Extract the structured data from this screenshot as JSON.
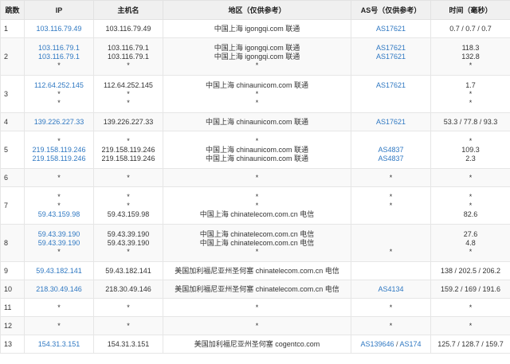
{
  "headers": {
    "hop": "跳数",
    "ip": "IP",
    "host": "主机名",
    "geo": "地区（仅供参考）",
    "as": "AS号（仅供参考）",
    "time": "时间（毫秒）"
  },
  "rows": [
    {
      "hop": "1",
      "ip": [
        "103.116.79.49"
      ],
      "host": [
        "103.116.79.49"
      ],
      "geo": [
        "中国上海 igongqi.com 联通"
      ],
      "as": [
        [
          "AS17621"
        ]
      ],
      "time": [
        "0.7 / 0.7 / 0.7"
      ]
    },
    {
      "hop": "2",
      "ip": [
        "103.116.79.1",
        "103.116.79.1",
        "*"
      ],
      "host": [
        "103.116.79.1",
        "103.116.79.1",
        "*"
      ],
      "geo": [
        "中国上海 igongqi.com 联通",
        "中国上海 igongqi.com 联通",
        "*"
      ],
      "as": [
        [
          "AS17621"
        ],
        [
          "AS17621"
        ],
        []
      ],
      "time": [
        "118.3",
        "132.8",
        "*"
      ]
    },
    {
      "hop": "3",
      "ip": [
        "112.64.252.145",
        "*",
        "*"
      ],
      "host": [
        "112.64.252.145",
        "*",
        "*"
      ],
      "geo": [
        "中国上海 chinaunicom.com 联通",
        "*",
        "*"
      ],
      "as": [
        [
          "AS17621"
        ],
        [],
        []
      ],
      "time": [
        "1.7",
        "*",
        "*"
      ]
    },
    {
      "hop": "4",
      "ip": [
        "139.226.227.33"
      ],
      "host": [
        "139.226.227.33"
      ],
      "geo": [
        "中国上海 chinaunicom.com 联通"
      ],
      "as": [
        [
          "AS17621"
        ]
      ],
      "time": [
        "53.3 / 77.8 / 93.3"
      ]
    },
    {
      "hop": "5",
      "ip": [
        "*",
        "219.158.119.246",
        "219.158.119.246"
      ],
      "host": [
        "*",
        "219.158.119.246",
        "219.158.119.246"
      ],
      "geo": [
        "*",
        "中国上海 chinaunicom.com 联通",
        "中国上海 chinaunicom.com 联通"
      ],
      "as": [
        [],
        [
          "AS4837"
        ],
        [
          "AS4837"
        ]
      ],
      "time": [
        "*",
        "109.3",
        "2.3"
      ]
    },
    {
      "hop": "6",
      "ip": [
        "*"
      ],
      "host": [
        "*"
      ],
      "geo": [
        "*"
      ],
      "as": [
        []
      ],
      "time": [
        "*"
      ],
      "as_star": [
        "*"
      ]
    },
    {
      "hop": "7",
      "ip": [
        "*",
        "*",
        "59.43.159.98"
      ],
      "host": [
        "*",
        "*",
        "59.43.159.98"
      ],
      "geo": [
        "*",
        "*",
        "中国上海 chinatelecom.com.cn 电信"
      ],
      "as": [
        [],
        [],
        []
      ],
      "time": [
        "*",
        "*",
        "82.6"
      ],
      "as_star": [
        "*",
        "*",
        ""
      ]
    },
    {
      "hop": "8",
      "ip": [
        "59.43.39.190",
        "59.43.39.190",
        "*"
      ],
      "host": [
        "59.43.39.190",
        "59.43.39.190",
        "*"
      ],
      "geo": [
        "中国上海 chinatelecom.com.cn 电信",
        "中国上海 chinatelecom.com.cn 电信",
        "*"
      ],
      "as": [
        [],
        [],
        []
      ],
      "time": [
        "27.6",
        "4.8",
        "*"
      ],
      "as_star": [
        "",
        "",
        "*"
      ]
    },
    {
      "hop": "9",
      "ip": [
        "59.43.182.141"
      ],
      "host": [
        "59.43.182.141"
      ],
      "geo": [
        "美国加利福尼亚州圣何塞 chinatelecom.com.cn 电信"
      ],
      "as": [
        []
      ],
      "time": [
        "138 / 202.5 / 206.2"
      ]
    },
    {
      "hop": "10",
      "ip": [
        "218.30.49.146"
      ],
      "host": [
        "218.30.49.146"
      ],
      "geo": [
        "美国加利福尼亚州圣何塞 chinatelecom.com.cn 电信"
      ],
      "as": [
        [
          "AS4134"
        ]
      ],
      "time": [
        "159.2 / 169 / 191.6"
      ]
    },
    {
      "hop": "11",
      "ip": [
        "*"
      ],
      "host": [
        "*"
      ],
      "geo": [
        "*"
      ],
      "as": [
        []
      ],
      "time": [
        "*"
      ],
      "as_star": [
        "*"
      ]
    },
    {
      "hop": "12",
      "ip": [
        "*"
      ],
      "host": [
        "*"
      ],
      "geo": [
        "*"
      ],
      "as": [
        []
      ],
      "time": [
        "*"
      ],
      "as_star": [
        "*"
      ]
    },
    {
      "hop": "13",
      "ip": [
        "154.31.3.151"
      ],
      "host": [
        "154.31.3.151"
      ],
      "geo": [
        "美国加利福尼亚州圣何塞 cogentco.com"
      ],
      "as": [
        [
          "AS139646",
          "AS174"
        ]
      ],
      "time": [
        "125.7 / 128.7 / 159.7"
      ]
    }
  ],
  "colors": {
    "link": "#2f78c2",
    "header_bg": "#f0f0f0",
    "alt_row_bg": "#f9f9f9",
    "border": "#e6e6e6"
  }
}
